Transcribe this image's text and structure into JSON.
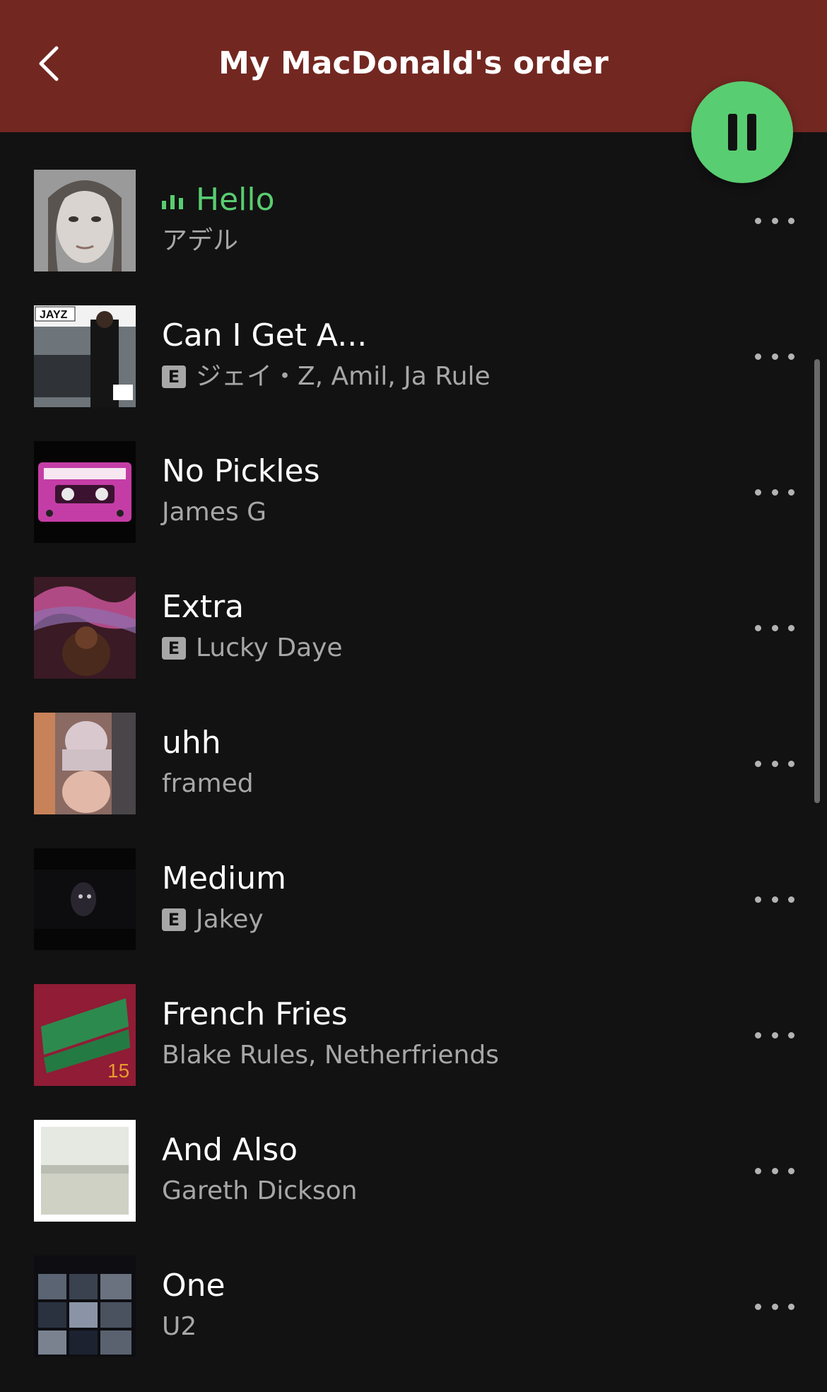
{
  "header": {
    "title": "My MacDonald's order",
    "background": "#732721"
  },
  "accent_color": "#59cd71",
  "play_state": "paused-icon-shown",
  "explicit_label": "E",
  "tracks": [
    {
      "title": "Hello",
      "artist": "アデル",
      "explicit": false,
      "playing": true,
      "art": "adele-portrait"
    },
    {
      "title": "Can I Get A...",
      "artist": "ジェイ・Z, Amil, Ja Rule",
      "explicit": true,
      "playing": false,
      "art": "jayz-vol2"
    },
    {
      "title": "No Pickles",
      "artist": "James G",
      "explicit": false,
      "playing": false,
      "art": "lofi-cassette"
    },
    {
      "title": "Extra",
      "artist": "Lucky Daye",
      "explicit": true,
      "playing": false,
      "art": "painted-cover"
    },
    {
      "title": "uhh",
      "artist": "framed",
      "explicit": false,
      "playing": false,
      "art": "framed-cover"
    },
    {
      "title": "Medium",
      "artist": "Jakey",
      "explicit": true,
      "playing": false,
      "art": "dark-figure"
    },
    {
      "title": "French Fries",
      "artist": "Blake Rules, Netherfriends",
      "explicit": false,
      "playing": false,
      "art": "kids-trap-15"
    },
    {
      "title": "And Also",
      "artist": "Gareth Dickson",
      "explicit": false,
      "playing": false,
      "art": "foggy-landscape"
    },
    {
      "title": "One",
      "artist": "U2",
      "explicit": false,
      "playing": false,
      "art": "u2-deluxe-edition"
    }
  ]
}
